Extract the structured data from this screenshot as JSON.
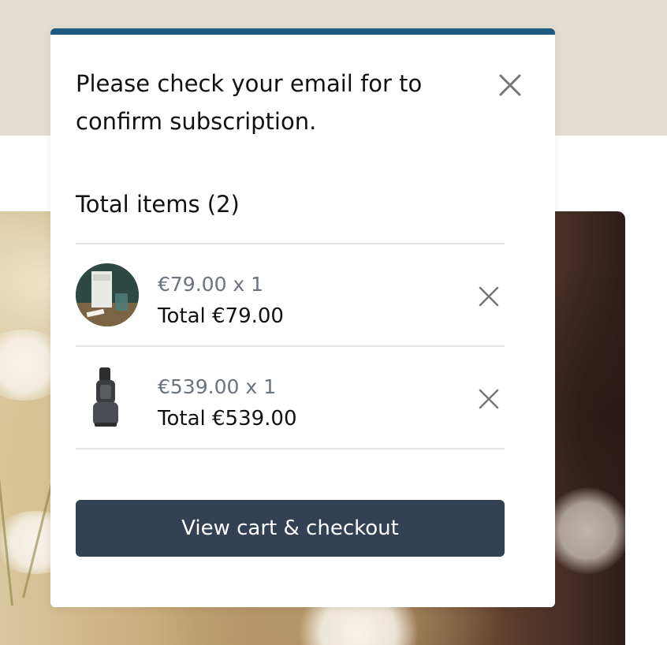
{
  "notification": {
    "message": "Please check your email for to confirm subscription.",
    "close_icon": "close-icon"
  },
  "cart": {
    "total_items_label": "Total items (2)",
    "items": [
      {
        "image": "supplement-bottle-and-glass-thumbnail",
        "price_qty": "€79.00 x 1",
        "line_total": "Total €79.00",
        "remove_icon": "close-icon"
      },
      {
        "image": "black-juicer-thumbnail",
        "price_qty": "€539.00 x 1",
        "line_total": "Total €539.00",
        "remove_icon": "close-icon"
      }
    ],
    "checkout_label": "View cart & checkout"
  },
  "colors": {
    "accent_bar": "#1f5a82",
    "checkout_button": "#334155",
    "muted_text": "#6b7280",
    "page_background_top": "#e1ddd3"
  }
}
